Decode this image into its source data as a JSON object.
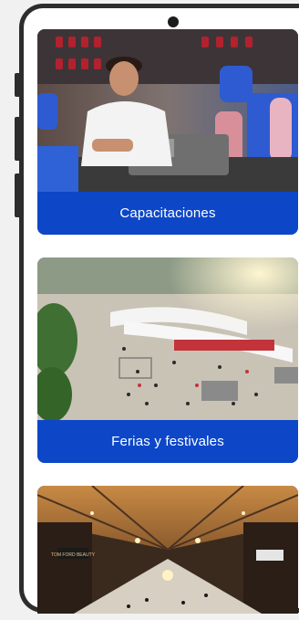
{
  "cards": [
    {
      "label": "Capacitaciones",
      "image": "workshop-photo"
    },
    {
      "label": "Ferias y festivales",
      "image": "fair-plaza-photo"
    },
    {
      "label": "",
      "image": "convention-hall-photo"
    }
  ],
  "signage": {
    "hall_sign_left": "TOM FORD BEAUTY"
  },
  "colors": {
    "card_label_background": "#0d47c8",
    "card_label_text": "#ffffff",
    "phone_frame": "#2d2d2d",
    "page_background": "#f1f1f1"
  }
}
